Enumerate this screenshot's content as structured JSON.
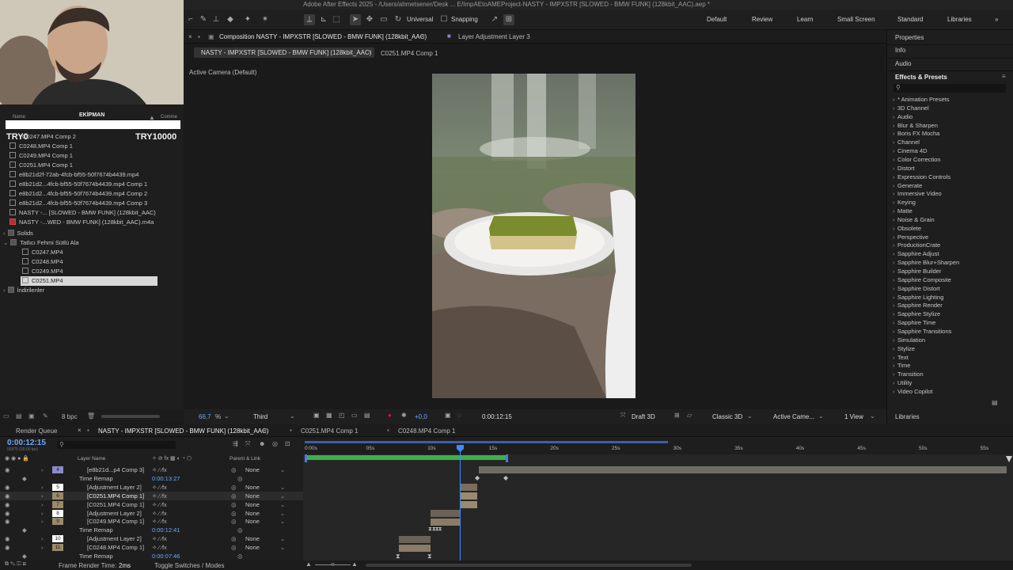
{
  "app": {
    "title": "Adobe After Effects 2025 - /Users/ahmetsener/Desk ... E/ImpAEtoAMEProject-NASTY - IMPXSTR [SLOWED - BMW FUNK] (128kbit_AAC).aep *"
  },
  "toolbar": {
    "universal_label": "Universal",
    "snapping_label": "Snapping",
    "workspaces": [
      "Default",
      "Review",
      "Learn",
      "Small Screen",
      "Standard",
      "Libraries"
    ],
    "more": "»"
  },
  "overlay": {
    "ekipman": "EKİPMAN",
    "try_left": "TRY0",
    "try_right": "TRY10000"
  },
  "project": {
    "col_name": "Name",
    "col_comment": "Comme",
    "items": [
      "C0247.MP4 Comp 2",
      "C0248.MP4 Comp 1",
      "C0249.MP4 Comp 1",
      "C0251.MP4 Comp 1",
      "e8b21d2f-72ab-4fcb-bf55-50f7674b4439.mp4",
      "e8b21d2...4fcb-bf55-50f7674b4439.mp4 Comp 1",
      "e8b21d2...4fcb-bf55-50f7674b4439.mp4 Comp 2",
      "e8b21d2...4fcb-bf55-50f7674b4439.mp4 Comp 3",
      "NASTY -... [SLOWED - BMW FUNK] (128kbit_AAC)",
      "NASTY -...WED - BMW FUNK] (128kbit_AAC).m4a",
      "Solids",
      "Tatlıcı Fehmi Sütlü Ala",
      "C0247.MP4",
      "C0248.MP4",
      "C0249.MP4",
      "C0251.MP4",
      "İndirilenler"
    ],
    "bpc": "8 bpc"
  },
  "comp": {
    "panel_title": "Composition NASTY - IMPXSTR [SLOWED - BMW FUNK] (128kbit_AAC)",
    "layer_panel_title": "Layer Adjustment Layer 3",
    "breadcrumb_active": "NASTY - IMPXSTR [SLOWED - BMW FUNK] (128kbit_AAC)",
    "breadcrumb_next": "C0251.MP4 Comp 1",
    "camera_label": "Active Camera (Default)",
    "zoom": "66,7",
    "zoom_unit": "%",
    "resolution": "Third",
    "exposure": "+0,0",
    "timecode": "0:00:12:15",
    "draft3d": "Draft 3D",
    "renderer": "Classic 3D",
    "camera_select": "Active Came...",
    "views": "1 View"
  },
  "right_panel": {
    "properties": "Properties",
    "info": "Info",
    "audio": "Audio",
    "effects_title": "Effects & Presets",
    "libraries": "Libraries",
    "categories": [
      "* Animation Presets",
      "3D Channel",
      "Audio",
      "Blur & Sharpen",
      "Boris FX Mocha",
      "Channel",
      "Cinema 4D",
      "Color Correction",
      "Distort",
      "Expression Controls",
      "Generate",
      "Immersive Video",
      "Keying",
      "Matte",
      "Noise & Grain",
      "Obsolete",
      "Perspective",
      "ProductionCrate",
      "Sapphire Adjust",
      "Sapphire Blur+Sharpen",
      "Sapphire Builder",
      "Sapphire Composite",
      "Sapphire Distort",
      "Sapphire Lighting",
      "Sapphire Render",
      "Sapphire Stylize",
      "Sapphire Time",
      "Sapphire Transitions",
      "Simulation",
      "Stylize",
      "Text",
      "Time",
      "Transition",
      "Utility",
      "Video Copilot"
    ]
  },
  "timeline": {
    "tabs": [
      "Render Queue",
      "NASTY - IMPXSTR [SLOWED - BMW FUNK] (128kbit_AAC)",
      "C0251.MP4 Comp 1",
      "C0248.MP4 Comp 1"
    ],
    "timecode": "0:00:12:15",
    "frames": "00375 (30.00 fps)",
    "col_layer_name": "Layer Name",
    "col_parent": "Parent & Link",
    "ruler": [
      "0:00s",
      "05s",
      "10s",
      "15s",
      "20s",
      "25s",
      "30s",
      "35s",
      "40s",
      "45s",
      "50s",
      "55s"
    ],
    "layers": [
      {
        "num": "4",
        "name": "[e8b21d...p4 Comp 3]",
        "parent": "None"
      },
      {
        "num": "",
        "name": "Time Remap",
        "parent": "0:00:13:27"
      },
      {
        "num": "5",
        "name": "[Adjustment Layer 2]",
        "parent": "None"
      },
      {
        "num": "6",
        "name": "[C0251.MP4 Comp 1]",
        "parent": "None"
      },
      {
        "num": "7",
        "name": "[C0251.MP4 Comp 1]",
        "parent": "None"
      },
      {
        "num": "8",
        "name": "[Adjustment Layer 2]",
        "parent": "None"
      },
      {
        "num": "9",
        "name": "[C0249.MP4 Comp 1]",
        "parent": "None"
      },
      {
        "num": "",
        "name": "Time Remap",
        "parent": "0:00:12:41"
      },
      {
        "num": "10",
        "name": "[Adjustment Layer 2]",
        "parent": "None"
      },
      {
        "num": "11",
        "name": "[C0248.MP4 Comp 1]",
        "parent": "None"
      },
      {
        "num": "",
        "name": "Time Remap",
        "parent": "0:00:07:46"
      }
    ],
    "frame_render_label": "Frame Render Time:",
    "frame_render_value": "2ms",
    "toggle_label": "Toggle Switches / Modes"
  }
}
